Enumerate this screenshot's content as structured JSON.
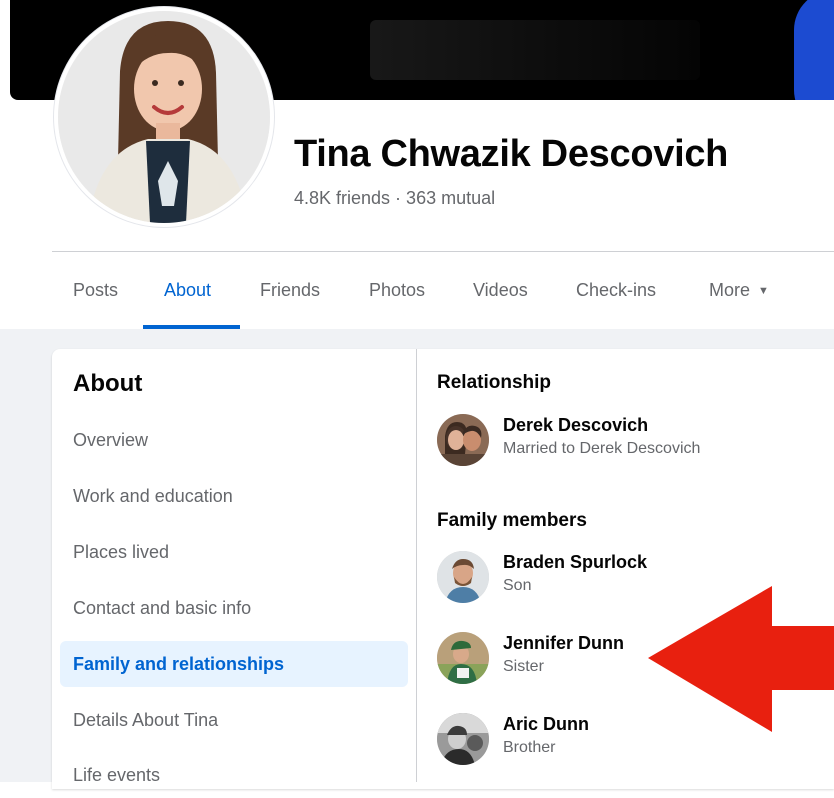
{
  "profile": {
    "name": "Tina Chwazik Descovich",
    "stats": "4.8K friends · 363 mutual"
  },
  "tabs": [
    {
      "label": "Posts"
    },
    {
      "label": "About"
    },
    {
      "label": "Friends"
    },
    {
      "label": "Photos"
    },
    {
      "label": "Videos"
    },
    {
      "label": "Check-ins"
    },
    {
      "label": "More"
    }
  ],
  "active_tab": "About",
  "about": {
    "title": "About",
    "items": [
      {
        "label": "Overview"
      },
      {
        "label": "Work and education"
      },
      {
        "label": "Places lived"
      },
      {
        "label": "Contact and basic info"
      },
      {
        "label": "Family and relationships"
      },
      {
        "label": "Details About Tina"
      },
      {
        "label": "Life events"
      }
    ],
    "active_item": "Family and relationships"
  },
  "relationship": {
    "title": "Relationship",
    "person": {
      "name": "Derek Descovich",
      "relation": "Married to Derek Descovich"
    }
  },
  "family": {
    "title": "Family members",
    "members": [
      {
        "name": "Braden Spurlock",
        "relation": "Son"
      },
      {
        "name": "Jennifer Dunn",
        "relation": "Sister"
      },
      {
        "name": "Aric Dunn",
        "relation": "Brother"
      }
    ]
  },
  "colors": {
    "accent": "#0064d1",
    "active_bg": "#e7f3ff",
    "annotation_arrow": "#e8200f",
    "secondary_text": "#65676b"
  }
}
